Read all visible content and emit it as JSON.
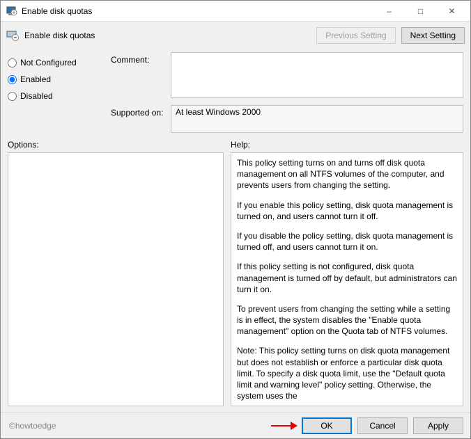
{
  "window": {
    "title": "Enable disk quotas"
  },
  "strip": {
    "title": "Enable disk quotas",
    "prev_btn": "Previous Setting",
    "next_btn": "Next Setting"
  },
  "radios": {
    "not_configured": "Not Configured",
    "enabled": "Enabled",
    "disabled": "Disabled",
    "selected": "enabled"
  },
  "labels": {
    "comment": "Comment:",
    "supported": "Supported on:",
    "options": "Options:",
    "help": "Help:"
  },
  "comment_value": "",
  "supported_value": "At least Windows 2000",
  "help": {
    "p1": "This policy setting turns on and turns off disk quota management on all NTFS volumes of the computer, and prevents users from changing the setting.",
    "p2": "If you enable this policy setting, disk quota management is turned on, and users cannot turn it off.",
    "p3": "If you disable the policy setting, disk quota management is turned off, and users cannot turn it on.",
    "p4": "If this policy setting is not configured, disk quota management is turned off by default, but administrators can turn it on.",
    "p5": "To prevent users from changing the setting while a setting is in effect, the system disables the \"Enable quota management\" option on the Quota tab of NTFS volumes.",
    "p6": "Note: This policy setting turns on disk quota management but does not establish or enforce a particular disk quota limit. To specify a disk quota limit, use the \"Default quota limit and warning level\" policy setting. Otherwise, the system uses the"
  },
  "footer": {
    "watermark": "©howtoedge",
    "ok": "OK",
    "cancel": "Cancel",
    "apply": "Apply"
  }
}
